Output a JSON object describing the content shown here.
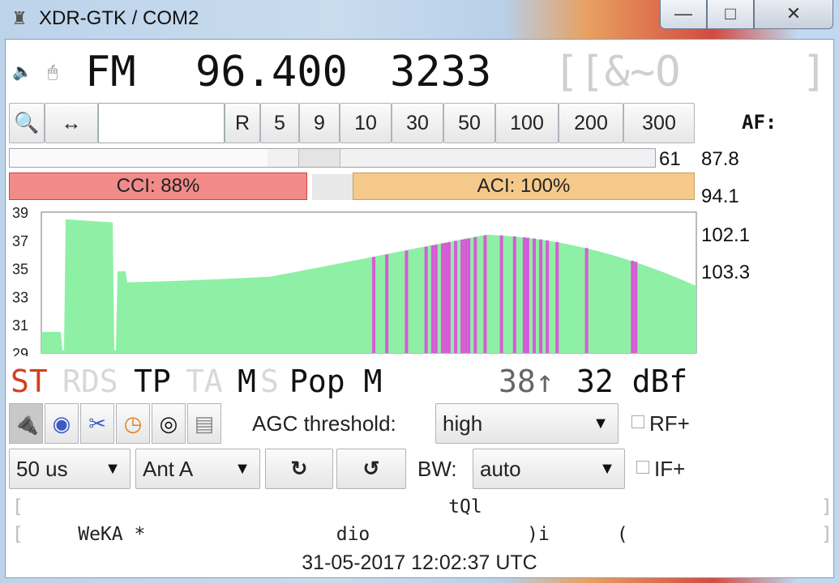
{
  "window": {
    "title": "XDR-GTK / COM2",
    "min_label": "—",
    "max_label": "□",
    "close_label": "✕"
  },
  "tuner": {
    "mode": "FM",
    "frequency": "96.400",
    "pi": "3233",
    "ps": "[[&~O",
    "ps_close": "]"
  },
  "toolbar": {
    "search_icon": "search-icon",
    "arrows_label": "↔",
    "steps": [
      "R",
      "5",
      "9",
      "10",
      "30",
      "50",
      "100",
      "200",
      "300"
    ],
    "af_label": "AF:"
  },
  "signal": {
    "level": "61",
    "level_fraction": 0.4,
    "cci_label": "CCI: 88%",
    "aci_label": "ACI: 100%",
    "cci_color": "#f28a8a",
    "aci_color": "#f5c98a"
  },
  "af_list": [
    "87.8",
    "94.1",
    "102.1",
    "103.3"
  ],
  "spectrum": {
    "y_ticks": [
      "39",
      "37",
      "35",
      "33",
      "31",
      "29"
    ],
    "ylim": [
      29,
      39
    ],
    "fill_color": "#8ef0a4",
    "highlight_color": "#d85ad8"
  },
  "status": {
    "st": "ST",
    "rds": "RDS",
    "tp": "TP",
    "ta": "TA",
    "m": "M",
    "s": "S",
    "pty": "Pop M",
    "level_peak": "38↑",
    "level": "32 dBf"
  },
  "controls": {
    "agc_label": "AGC threshold:",
    "agc_value": "high",
    "rf_label": "RF+",
    "deemphasis": "50 us",
    "antenna": "Ant A",
    "rotate_cw": "↻",
    "rotate_ccw": "↺",
    "bw_label": "BW:",
    "bw_value": "auto",
    "if_label": "IF+"
  },
  "rds": {
    "line1": "                                      tQl",
    "line2": "     WeKA *                 dio              )i      (",
    "timestamp": "31-05-2017 12:02:37 UTC"
  }
}
